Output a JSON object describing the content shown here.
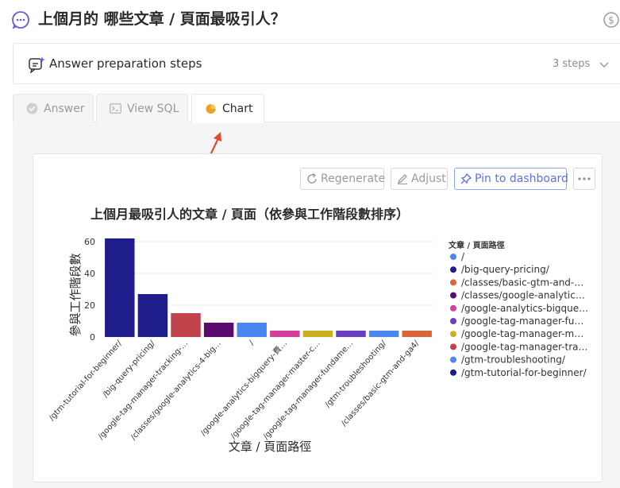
{
  "header": {
    "title": "上個月的 哪些文章 / 頁面最吸引人？"
  },
  "steps": {
    "label": "Answer preparation steps",
    "count": "3 steps"
  },
  "tabs": [
    {
      "label": "Answer"
    },
    {
      "label": "View SQL"
    },
    {
      "label": "Chart"
    }
  ],
  "toolbar": {
    "regenerate": "Regenerate",
    "adjust": "Adjust",
    "pin": "Pin to dashboard"
  },
  "colors": {
    "accent": "#5a73e0",
    "chart_tab_icon": "#f0a020",
    "arrow": "#e04a2a"
  },
  "icons": {
    "question": "chat-bubble-dots-icon",
    "credit": "dollar-circle-icon",
    "steps": "sparkle-message-icon",
    "chevron": "chevron-down-icon",
    "answer": "check-circle-icon",
    "sql": "terminal-icon",
    "chart": "pie-chart-icon",
    "regenerate": "refresh-icon",
    "adjust": "edit-icon",
    "pin": "pin-icon",
    "more": "more-dots-icon"
  },
  "chart_data": {
    "type": "bar",
    "title": "上個月最吸引人的文章 / 頁面（依參與工作階段數排序）",
    "xlabel": "文章 / 頁面路徑",
    "ylabel": "參與工作階段數",
    "ylim": [
      0,
      65
    ],
    "yticks": [
      0,
      20,
      40,
      60
    ],
    "grid": true,
    "legend_position": "right",
    "legend_title": "文章 / 頁面路徑",
    "categories": [
      "/gtm-tutorial-for-beginner/",
      "/big-query-pricing/",
      "/google-tag-manager-tracking-…",
      "/classes/google-analytics-4-big…",
      "/",
      "/google-analytics-bigquery-費…",
      "/google-tag-manager-master-c…",
      "/google-tag-manager-fundame…",
      "/gtm-troubleshooting/",
      "/classes/basic-gtm-and-ga4/"
    ],
    "values": [
      62,
      27,
      15,
      9,
      9,
      4,
      4,
      4,
      4,
      4
    ],
    "bar_colors": [
      "#1f1d8c",
      "#1f1d8c",
      "#c0424a",
      "#5a0c6e",
      "#4a86ef",
      "#d43f9a",
      "#c8b020",
      "#6a3fbf",
      "#4a86ef",
      "#d8663a"
    ],
    "legend": [
      {
        "label": "/",
        "color": "#4a86ef"
      },
      {
        "label": "/big-query-pricing/",
        "color": "#1f1d8c"
      },
      {
        "label": "/classes/basic-gtm-and-…",
        "color": "#d8663a"
      },
      {
        "label": "/classes/google-analytic…",
        "color": "#5a0c6e"
      },
      {
        "label": "/google-analytics-bigque…",
        "color": "#d43f9a"
      },
      {
        "label": "/google-tag-manager-fu…",
        "color": "#6a3fbf"
      },
      {
        "label": "/google-tag-manager-m…",
        "color": "#c8b020"
      },
      {
        "label": "/google-tag-manager-tra…",
        "color": "#c0424a"
      },
      {
        "label": "/gtm-troubleshooting/",
        "color": "#4a86ef"
      },
      {
        "label": "/gtm-tutorial-for-beginner/",
        "color": "#1f1d8c"
      }
    ]
  }
}
